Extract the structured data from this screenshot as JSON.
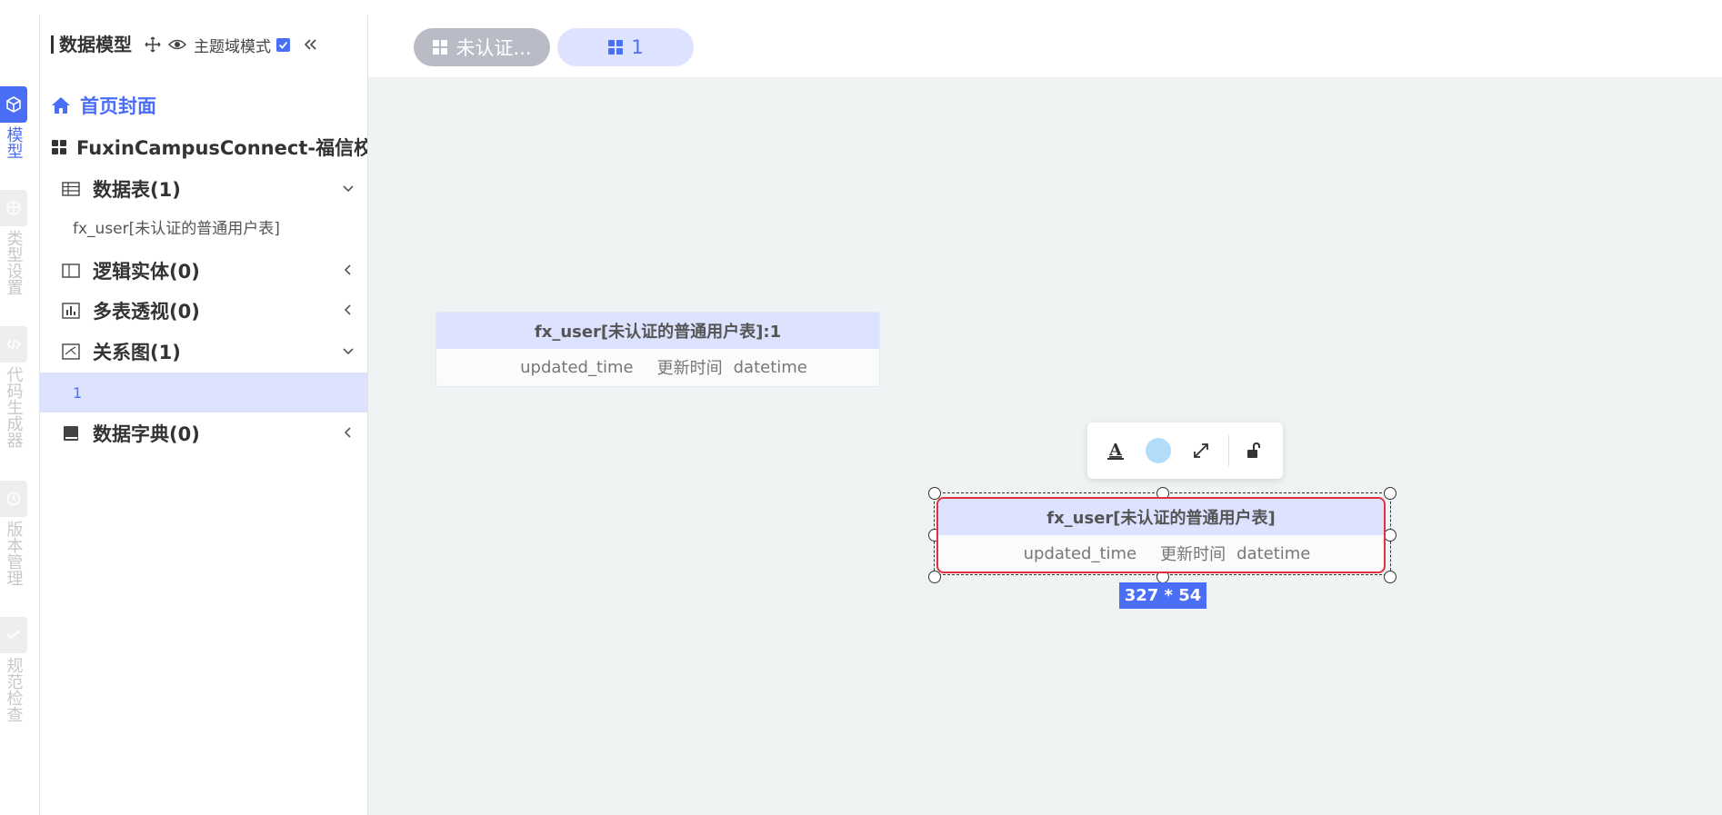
{
  "sidebar": {
    "title": "数据模型",
    "mode_label": "主题域模式",
    "home": "首页封面",
    "project": "FuxinCampusConnect-福信校园",
    "groups": {
      "tables": "数据表(1)",
      "entities": "逻辑实体(0)",
      "pivot": "多表透视(0)",
      "diagrams": "关系图(1)",
      "dicts": "数据字典(0)"
    },
    "table_item": "fx_user[未认证的普通用户表]",
    "diagram_item": "1"
  },
  "rail": {
    "items": [
      {
        "label": "模型",
        "icon": "cube-icon"
      },
      {
        "label": "类型设置",
        "icon": "palette-icon"
      },
      {
        "label": "代码生成器",
        "icon": "code-icon"
      },
      {
        "label": "版本管理",
        "icon": "history-icon"
      },
      {
        "label": "规范检查",
        "icon": "check-icon"
      }
    ]
  },
  "tabs": [
    {
      "label": "未认证..."
    },
    {
      "label": "1"
    }
  ],
  "canvas": {
    "entity1": {
      "title": "fx_user[未认证的普通用户表]:1",
      "field_name": "updated_time",
      "field_comment": "更新时间",
      "field_type": "datetime"
    },
    "entity2": {
      "title": "fx_user[未认证的普通用户表]",
      "field_name": "updated_time",
      "field_comment": "更新时间",
      "field_type": "datetime"
    },
    "size_badge": "327 * 54",
    "fill_color": "#b3dcfa"
  },
  "colors": {
    "accent": "#4b6ef6",
    "selection_border": "#e0313c",
    "header_bg": "#dde3ff",
    "canvas_bg": "#f0f3f4"
  }
}
